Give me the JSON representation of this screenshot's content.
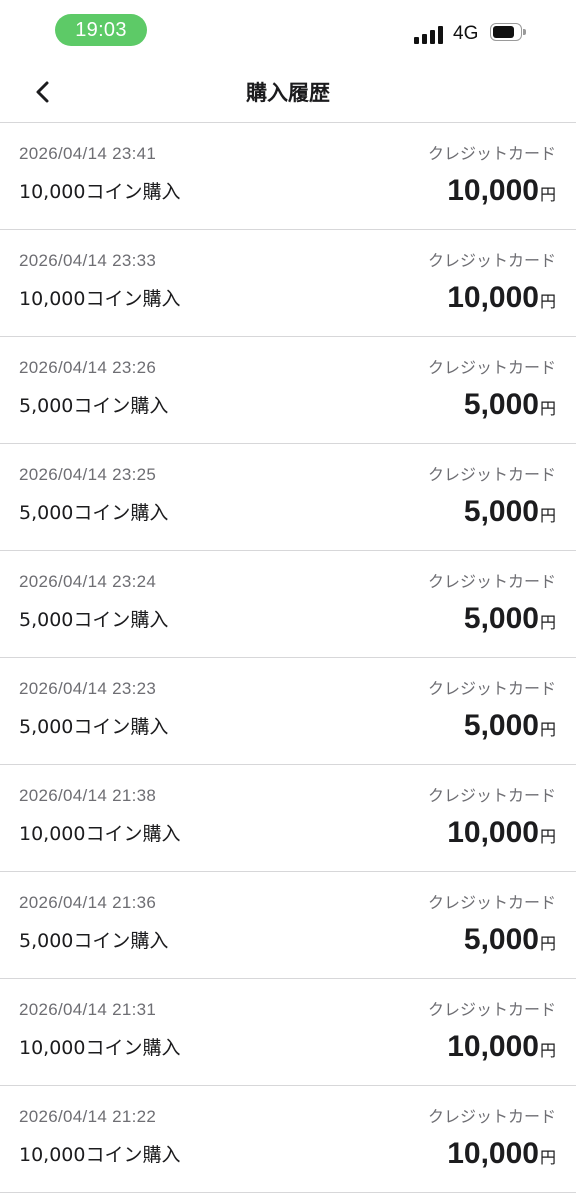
{
  "status_bar": {
    "time": "19:03",
    "network": "4G",
    "battery_level": 0.8
  },
  "header": {
    "title": "購入履歴",
    "back_icon": "chevron-left-icon"
  },
  "purchases": [
    {
      "date": "2026/04/14 23:41",
      "item": "10,000コイン購入",
      "method": "クレジットカード",
      "amount": "10,000",
      "unit": "円"
    },
    {
      "date": "2026/04/14 23:33",
      "item": "10,000コイン購入",
      "method": "クレジットカード",
      "amount": "10,000",
      "unit": "円"
    },
    {
      "date": "2026/04/14 23:26",
      "item": "5,000コイン購入",
      "method": "クレジットカード",
      "amount": "5,000",
      "unit": "円"
    },
    {
      "date": "2026/04/14 23:25",
      "item": "5,000コイン購入",
      "method": "クレジットカード",
      "amount": "5,000",
      "unit": "円"
    },
    {
      "date": "2026/04/14 23:24",
      "item": "5,000コイン購入",
      "method": "クレジットカード",
      "amount": "5,000",
      "unit": "円"
    },
    {
      "date": "2026/04/14 23:23",
      "item": "5,000コイン購入",
      "method": "クレジットカード",
      "amount": "5,000",
      "unit": "円"
    },
    {
      "date": "2026/04/14 21:38",
      "item": "10,000コイン購入",
      "method": "クレジットカード",
      "amount": "10,000",
      "unit": "円"
    },
    {
      "date": "2026/04/14 21:36",
      "item": "5,000コイン購入",
      "method": "クレジットカード",
      "amount": "5,000",
      "unit": "円"
    },
    {
      "date": "2026/04/14 21:31",
      "item": "10,000コイン購入",
      "method": "クレジットカード",
      "amount": "10,000",
      "unit": "円"
    },
    {
      "date": "2026/04/14 21:22",
      "item": "10,000コイン購入",
      "method": "クレジットカード",
      "amount": "10,000",
      "unit": "円"
    }
  ],
  "colors": {
    "time_pill": "#5dca67",
    "primary_text": "#1c1c1e",
    "secondary_text": "#6e6e73",
    "divider": "#d7d7d9"
  }
}
